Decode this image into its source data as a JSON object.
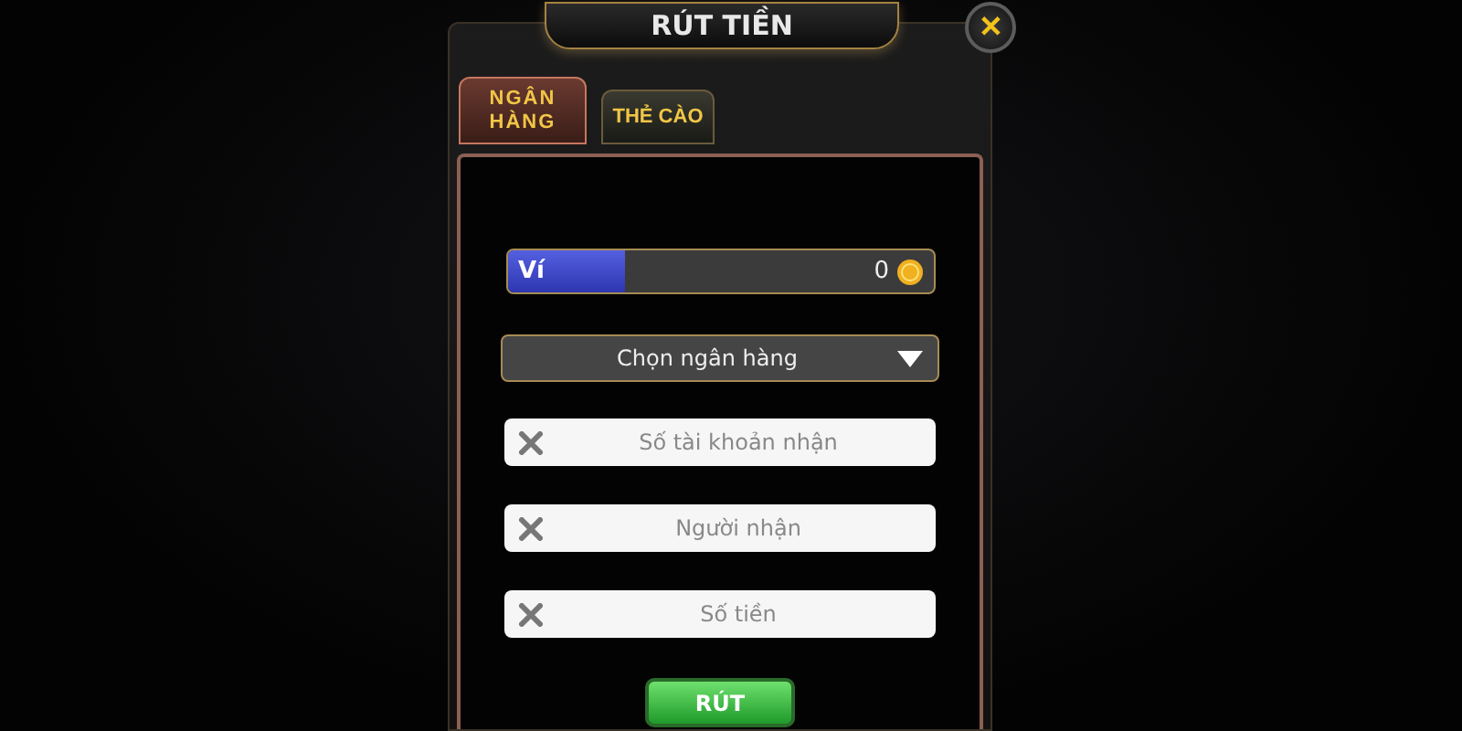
{
  "dialog": {
    "title": "RÚT TIỀN",
    "close_label": "✕"
  },
  "tabs": [
    {
      "label": "NGÂN HÀNG",
      "selected": true
    },
    {
      "label": "THẺ CÀO",
      "selected": false
    }
  ],
  "wallet": {
    "label": "Ví",
    "amount": "0"
  },
  "bank_select": {
    "value": "Chọn ngân hàng"
  },
  "fields": [
    {
      "placeholder": "Số tài khoản nhận"
    },
    {
      "placeholder": "Người nhận"
    },
    {
      "placeholder": "Số tiền"
    }
  ],
  "submit": {
    "label": "RÚT"
  }
}
